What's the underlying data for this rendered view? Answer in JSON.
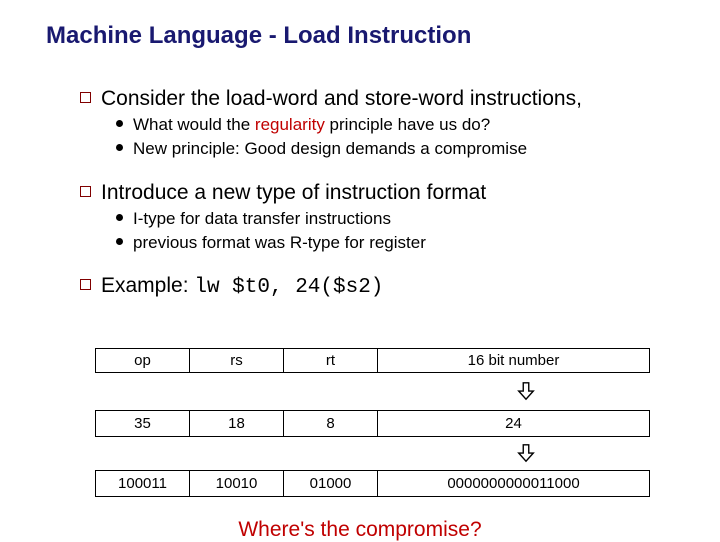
{
  "title": "Machine Language - Load Instruction",
  "b1": {
    "text": "Consider the load-word and store-word instructions,",
    "s1a": "What would the ",
    "s1b": "regularity",
    "s1c": " principle have us do?",
    "s2": "New principle:  Good design demands a compromise"
  },
  "b2": {
    "text": "Introduce a new type of instruction format",
    "s1": "I-type for data transfer instructions",
    "s2": "previous format was R-type for register"
  },
  "b3": {
    "pre": "Example:  ",
    "code": "lw  $t0, 24($s2)"
  },
  "fields": {
    "r0": {
      "op": "op",
      "rs": "rs",
      "rt": "rt",
      "imm": "16 bit number"
    },
    "r1": {
      "op": "35",
      "rs": "18",
      "rt": "8",
      "imm": "24"
    },
    "r2": {
      "op": "100011",
      "rs": "10010",
      "rt": "01000",
      "imm": "0000000000011000"
    }
  },
  "compromise": "Where's the compromise?"
}
